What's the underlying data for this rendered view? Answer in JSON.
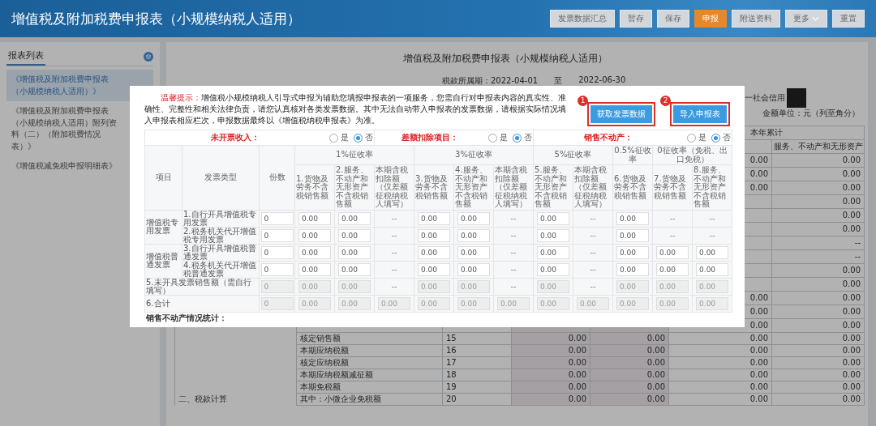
{
  "header": {
    "title": "增值税及附加税费申报表（小规模纳税人适用）",
    "buttons": [
      {
        "label": "发票数据汇总",
        "kind": "plain"
      },
      {
        "label": "暂存",
        "kind": "plain"
      },
      {
        "label": "保存",
        "kind": "plain"
      },
      {
        "label": "申报",
        "kind": "primary"
      },
      {
        "label": "附送资料",
        "kind": "plain"
      },
      {
        "label": "更多",
        "kind": "menu"
      },
      {
        "label": "重置",
        "kind": "plain"
      }
    ]
  },
  "sidebar": {
    "tab": "报表列表",
    "items": [
      {
        "label": "《增值税及附加税费申报表（小规模纳税人适用）》",
        "selected": true
      },
      {
        "label": "《增值税及附加税费申报表（小规模纳税人适用）附列资料（二）（附加税费情况表）》",
        "selected": false
      },
      {
        "label": "《增值税减免税申报明细表》",
        "selected": false
      }
    ]
  },
  "form": {
    "title": "增值税及附加税费申报表（小规模纳税人适用）",
    "period_label": "税款所属期：",
    "period_start": "2022-04-01",
    "period_sep": "至",
    "period_end": "2022-06-30",
    "credit_label": "一社会信用",
    "unit": "金额单位：元（列至角分）",
    "table": {
      "header_group": "本年累计",
      "header_sub": "服务、不动产和无形资产",
      "rows": [
        {
          "v3": "0.00",
          "v4": "0.00"
        },
        {
          "v3": "0.00",
          "v4": "0.00"
        },
        {
          "v3": "0.00",
          "v4": "0.00"
        },
        {
          "v4": "0.00"
        },
        {
          "v4": "0.00"
        },
        {
          "v4": "0.00"
        },
        {
          "v4": "--"
        },
        {
          "v4": "--"
        },
        {
          "v4": "0.00"
        },
        {
          "v4": "0.00"
        },
        {
          "v3": "0.00",
          "v4": "0.00"
        },
        {
          "v3": "0.00",
          "v4": "0.00"
        },
        {
          "v3": "0.00",
          "v4": "0.00"
        },
        {
          "label": "核定销售额",
          "num": "15",
          "v1": "0.00",
          "v2": "0.00",
          "v3": "0.00",
          "v4": "0.00"
        },
        {
          "label": "本期应纳税额",
          "num": "16",
          "v1": "0.00",
          "v2": "0.00",
          "v3": "0.00",
          "v4": "0.00"
        },
        {
          "label": "核定应纳税额",
          "num": "17",
          "v1": "0.00",
          "v2": "0.00",
          "v3": "0.00",
          "v4": "0.00"
        },
        {
          "label": "本期应纳税额减征额",
          "num": "18",
          "v1": "0.00",
          "v2": "0.00",
          "v3": "0.00",
          "v4": "0.00"
        },
        {
          "label": "本期免税额",
          "num": "19",
          "v1": "0.00",
          "v2": "0.00",
          "v3": "0.00",
          "v4": "0.00"
        },
        {
          "group": "二、税款计算",
          "label": "其中：小微企业免税额",
          "num": "20",
          "v1": "0.00",
          "v2": "0.00",
          "v3": "0.00",
          "v4": "0.00"
        }
      ]
    }
  },
  "dialog": {
    "notice_label": "温馨提示：",
    "notice": "增值税小规模纳税人引导式申报为辅助您填报申报表的一项服务，您需自行对申报表内容的真实性、准确性、完整性和相关法律负责，请您认真核对各类发票数据。其中无法自动带入申报表的发票数据，请根据实际情况填入申报表相应栏次，申报数据最终以《增值税纳税申报表》为准。",
    "actions": [
      {
        "badge": "1",
        "label": "获取发票数据"
      },
      {
        "badge": "2",
        "label": "导入申报表"
      }
    ],
    "toggles": [
      {
        "label": "未开票收入：",
        "options": [
          {
            "label": "是",
            "selected": false
          },
          {
            "label": "否",
            "selected": true
          }
        ]
      },
      {
        "label": "差额扣除项目：",
        "options": [
          {
            "label": "是",
            "selected": false
          },
          {
            "label": "否",
            "selected": true
          }
        ]
      },
      {
        "label": "销售不动产：",
        "options": [
          {
            "label": "是",
            "selected": false
          },
          {
            "label": "否",
            "selected": true
          }
        ]
      }
    ],
    "table": {
      "item_header": "项目",
      "type_header": "发票类型",
      "count_header": "份数",
      "rate_groups": [
        {
          "label": "1%征收率",
          "columns": [
            "1.货物及劳务不含税销售额",
            "2.服务、不动产和无形资产不含税销售额",
            "本期含税扣除额（仅差额征税纳税人填写）"
          ]
        },
        {
          "label": "3%征收率",
          "columns": [
            "3.货物及劳务不含税销售额",
            "4.服务、不动产和无形资产不含税销售额",
            "本期含税扣除额（仅差额征税纳税人填写）"
          ]
        },
        {
          "label": "5%征收率",
          "columns": [
            "5.服务、不动产和无形资产不含税销售额",
            "本期含税扣除额（仅差额征税纳税人填写）"
          ]
        },
        {
          "label": "0.5%征收率",
          "columns": [
            "6.货物及劳务不含税销售额"
          ]
        },
        {
          "label": "0征收率（免税、出口免税）",
          "columns": [
            "7.货物及劳务不含税销售额",
            "8.服务、不动产和无形资产不含税销售额"
          ]
        }
      ],
      "groups": [
        {
          "label": "增值税专用发票",
          "rows": [
            {
              "label": "1.自行开具增值税专用发票",
              "disabled": false,
              "cells": [
                {
                  "kind": "field",
                  "text": "0"
                },
                {
                  "kind": "field",
                  "text": "0.00"
                },
                {
                  "kind": "field",
                  "text": "0.00"
                },
                {
                  "kind": "dash",
                  "text": "--"
                },
                {
                  "kind": "field",
                  "text": "0.00"
                },
                {
                  "kind": "field",
                  "text": "0.00"
                },
                {
                  "kind": "dash",
                  "text": "--"
                },
                {
                  "kind": "field",
                  "text": "0.00"
                },
                {
                  "kind": "dash",
                  "text": "--"
                },
                {
                  "kind": "field",
                  "text": "0.00"
                },
                {
                  "kind": "dash",
                  "text": "--"
                },
                {
                  "kind": "dash",
                  "text": "--"
                }
              ]
            },
            {
              "label": "2.税务机关代开增值税专用发票",
              "disabled": false,
              "cells": [
                {
                  "kind": "field",
                  "text": "0"
                },
                {
                  "kind": "field",
                  "text": "0.00"
                },
                {
                  "kind": "field",
                  "text": "0.00"
                },
                {
                  "kind": "dash",
                  "text": "--"
                },
                {
                  "kind": "field",
                  "text": "0.00"
                },
                {
                  "kind": "field",
                  "text": "0.00"
                },
                {
                  "kind": "dash",
                  "text": "--"
                },
                {
                  "kind": "field",
                  "text": "0.00"
                },
                {
                  "kind": "dash",
                  "text": "--"
                },
                {
                  "kind": "field",
                  "text": "0.00"
                },
                {
                  "kind": "dash",
                  "text": "--"
                },
                {
                  "kind": "dash",
                  "text": "--"
                }
              ]
            }
          ]
        },
        {
          "label": "增值税普通发票",
          "rows": [
            {
              "label": "3.自行开具增值税普通发票",
              "disabled": false,
              "cells": [
                {
                  "kind": "field",
                  "text": "0"
                },
                {
                  "kind": "field",
                  "text": "0.00"
                },
                {
                  "kind": "field",
                  "text": "0.00"
                },
                {
                  "kind": "dash",
                  "text": "--"
                },
                {
                  "kind": "field",
                  "text": "0.00"
                },
                {
                  "kind": "field",
                  "text": "0.00"
                },
                {
                  "kind": "dash",
                  "text": "--"
                },
                {
                  "kind": "field",
                  "text": "0.00"
                },
                {
                  "kind": "dash",
                  "text": "--"
                },
                {
                  "kind": "field",
                  "text": "0.00"
                },
                {
                  "kind": "field",
                  "text": "0.00"
                },
                {
                  "kind": "field",
                  "text": "0.00"
                }
              ]
            },
            {
              "label": "4.税务机关代开增值税普通发票",
              "disabled": false,
              "cells": [
                {
                  "kind": "field",
                  "text": "0"
                },
                {
                  "kind": "field",
                  "text": "0.00"
                },
                {
                  "kind": "field",
                  "text": "0.00"
                },
                {
                  "kind": "dash",
                  "text": "--"
                },
                {
                  "kind": "field",
                  "text": "0.00"
                },
                {
                  "kind": "field",
                  "text": "0.00"
                },
                {
                  "kind": "dash",
                  "text": "--"
                },
                {
                  "kind": "field",
                  "text": "0.00"
                },
                {
                  "kind": "dash",
                  "text": "--"
                },
                {
                  "kind": "field",
                  "text": "0.00"
                },
                {
                  "kind": "field",
                  "text": "0.00"
                },
                {
                  "kind": "field",
                  "text": "0.00"
                }
              ]
            }
          ]
        }
      ],
      "extra_rows": [
        {
          "label": "5.未开具发票销售额（需自行填写）",
          "disabled": true,
          "cells": [
            {
              "kind": "field",
              "text": "0"
            },
            {
              "kind": "field",
              "text": "0.00"
            },
            {
              "kind": "field",
              "text": "0.00"
            },
            {
              "kind": "dash",
              "text": "--"
            },
            {
              "kind": "field",
              "text": "0.00"
            },
            {
              "kind": "field",
              "text": "0.00"
            },
            {
              "kind": "dash",
              "text": "--"
            },
            {
              "kind": "field",
              "text": "0.00"
            },
            {
              "kind": "dash",
              "text": "--"
            },
            {
              "kind": "field",
              "text": "0.00"
            },
            {
              "kind": "field",
              "text": "0.00"
            },
            {
              "kind": "field",
              "text": "0.00"
            }
          ]
        },
        {
          "label": "6.合计",
          "disabled": true,
          "cells": [
            {
              "kind": "field",
              "text": "0"
            },
            {
              "kind": "field",
              "text": "0.00"
            },
            {
              "kind": "field",
              "text": "0.00"
            },
            {
              "kind": "field",
              "text": "0.00"
            },
            {
              "kind": "field",
              "text": "0.00"
            },
            {
              "kind": "field",
              "text": "0.00"
            },
            {
              "kind": "field",
              "text": "0.00"
            },
            {
              "kind": "field",
              "text": "0.00"
            },
            {
              "kind": "field",
              "text": "0.00"
            },
            {
              "kind": "field",
              "text": "0.00"
            },
            {
              "kind": "field",
              "text": "0.00"
            },
            {
              "kind": "field",
              "text": "0.00"
            }
          ]
        }
      ],
      "section": "销售不动产情况统计："
    }
  }
}
